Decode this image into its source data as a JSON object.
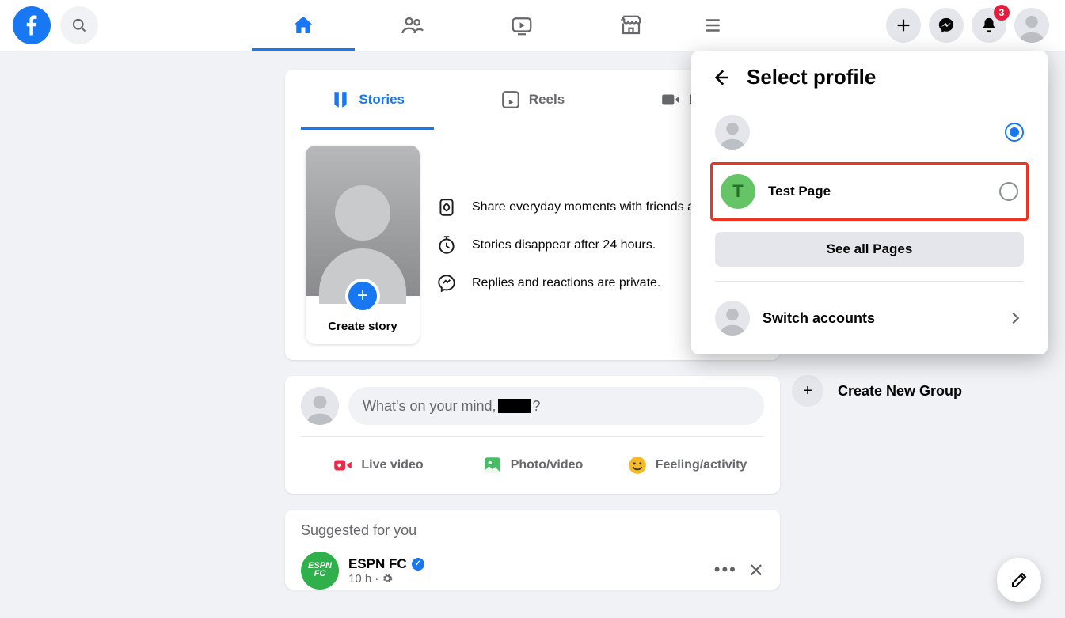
{
  "notifications": {
    "count": "3"
  },
  "storyTabs": {
    "stories": "Stories",
    "reels": "Reels",
    "rooms": "Rooms"
  },
  "storyCard": {
    "create": "Create story"
  },
  "storyInfo": {
    "a": "Share everyday moments with friends and family.",
    "b": "Stories disappear after 24 hours.",
    "c": "Replies and reactions are private."
  },
  "composer": {
    "prefix": "What's on your mind, ",
    "suffix": "?",
    "live": "Live video",
    "photo": "Photo/video",
    "feeling": "Feeling/activity"
  },
  "suggested": {
    "title": "Suggested for you",
    "name": "ESPN FC",
    "time": "10 h",
    "avatarText": "ESPN\nFC"
  },
  "popup": {
    "title": "Select profile",
    "pageLetter": "T",
    "pageName": "Test Page",
    "seeAll": "See all Pages",
    "switch": "Switch accounts"
  },
  "createGroup": "Create New Group"
}
